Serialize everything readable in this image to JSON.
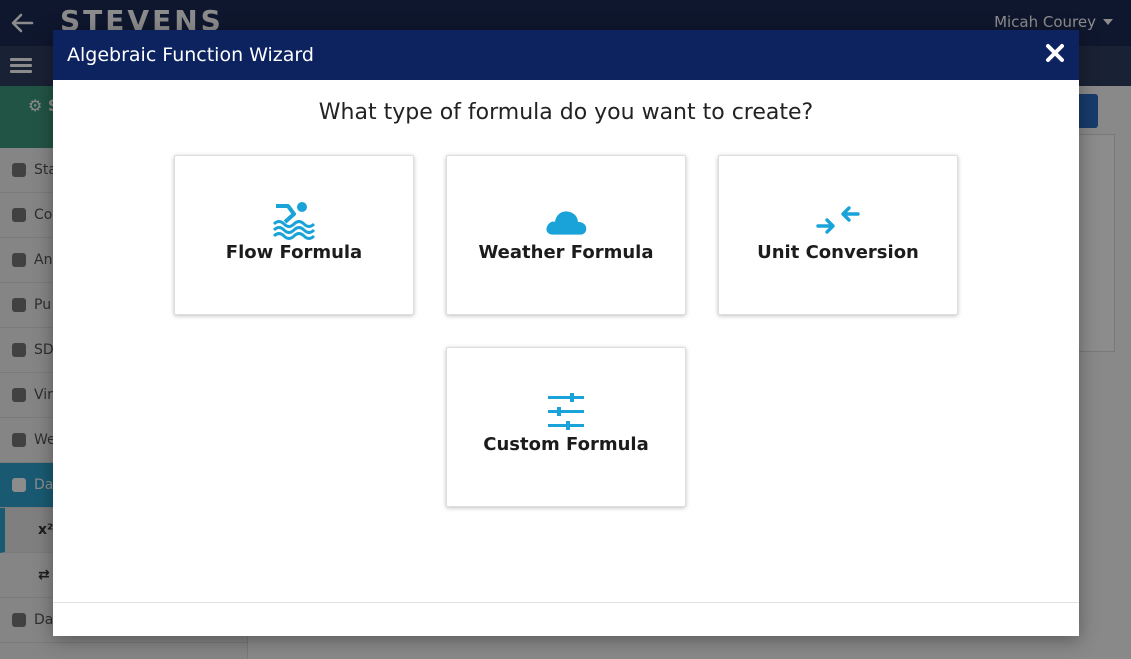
{
  "app": {
    "logo": "STEVENS",
    "user_name": "Micah Courey",
    "sidebar_items": [
      "Sta",
      "Co",
      "An",
      "Pu",
      "SD",
      "Vir",
      "We",
      "Da"
    ],
    "sidebar_subitems": [
      "x²",
      "⇄"
    ],
    "sidebar_bottom": "Da"
  },
  "modal": {
    "title": "Algebraic Function Wizard",
    "question": "What type of formula do you want to create?",
    "options": [
      {
        "label": "Flow Formula",
        "icon": "swimmer-icon"
      },
      {
        "label": "Weather Formula",
        "icon": "cloud-icon"
      },
      {
        "label": "Unit Conversion",
        "icon": "compress-arrows-icon"
      },
      {
        "label": "Custom Formula",
        "icon": "sliders-icon"
      }
    ]
  },
  "colors": {
    "header_bg": "#0c2360",
    "icon_accent": "#1aa3d9",
    "topbar_bg": "#1c2a54",
    "sidebar_head": "#3e9a7e",
    "sidebar_active": "#2fa5cf"
  }
}
